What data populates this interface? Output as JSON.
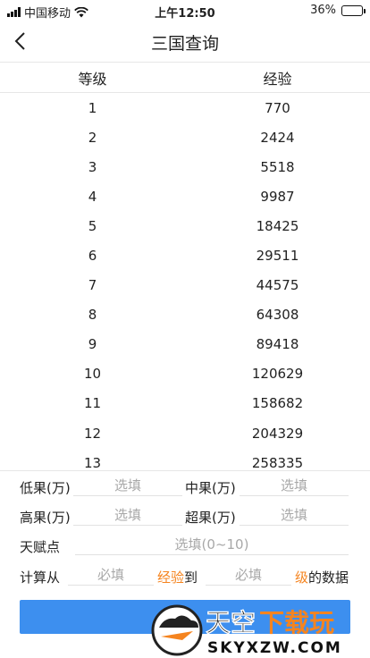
{
  "status": {
    "carrier": "中国移动",
    "time": "上午12:50",
    "battery": "36%",
    "battery_level": 0.36,
    "icons": [
      "signal-icon",
      "wifi-icon",
      "battery-icon"
    ]
  },
  "nav": {
    "title": "三国查询",
    "back_icon": "chevron-left-icon"
  },
  "table": {
    "headers": [
      "等级",
      "经验"
    ],
    "rows": [
      [
        "1",
        "770"
      ],
      [
        "2",
        "2424"
      ],
      [
        "3",
        "5518"
      ],
      [
        "4",
        "9987"
      ],
      [
        "5",
        "18425"
      ],
      [
        "6",
        "29511"
      ],
      [
        "7",
        "44575"
      ],
      [
        "8",
        "64308"
      ],
      [
        "9",
        "89418"
      ],
      [
        "10",
        "120629"
      ],
      [
        "11",
        "158682"
      ],
      [
        "12",
        "204329"
      ],
      [
        "13",
        "258335"
      ]
    ]
  },
  "form": {
    "low_fruit_label": "低果(万)",
    "mid_fruit_label": "中果(万)",
    "high_fruit_label": "高果(万)",
    "super_fruit_label": "超果(万)",
    "optional_placeholder": "选填",
    "talent_label": "天赋点",
    "talent_placeholder": "选填(0~10)",
    "calc_from": "计算从",
    "required_placeholder": "必填",
    "exp_word": "经验",
    "to_word": "到",
    "level_word": "级",
    "data_word": "的数据"
  },
  "watermark": {
    "brand": "天空下载玩",
    "domain": "SKYXZW.COM"
  },
  "colors": {
    "accent": "#f5841f",
    "button": "#3d8fef"
  }
}
